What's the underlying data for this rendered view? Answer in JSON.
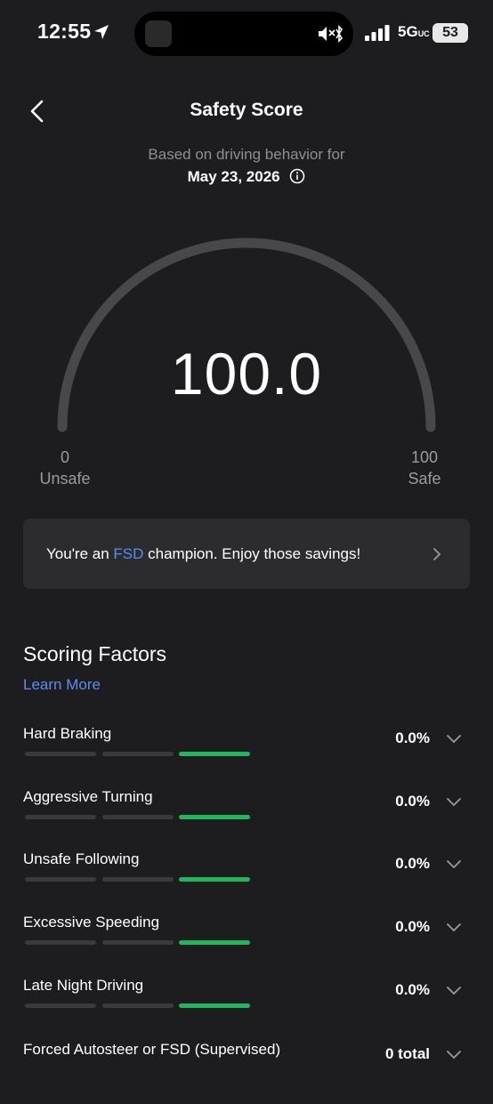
{
  "status_bar": {
    "time": "12:55",
    "network": "5G",
    "network_suffix": "UC",
    "battery": "53"
  },
  "header": {
    "title": "Safety Score",
    "subtitle": "Based on driving behavior for",
    "date": "May 23, 2026"
  },
  "gauge": {
    "score": "100.0",
    "min_value": "0",
    "min_label": "Unsafe",
    "max_value": "100",
    "max_label": "Safe"
  },
  "banner": {
    "text_before": "You're an ",
    "highlight": "FSD",
    "text_after": " champion. Enjoy those savings!"
  },
  "scoring": {
    "title": "Scoring Factors",
    "learn_more": "Learn More",
    "factors": [
      {
        "name": "Hard Braking",
        "value": "0.0%",
        "level": 3
      },
      {
        "name": "Aggressive Turning",
        "value": "0.0%",
        "level": 3
      },
      {
        "name": "Unsafe Following",
        "value": "0.0%",
        "level": 3
      },
      {
        "name": "Excessive Speeding",
        "value": "0.0%",
        "level": 3
      },
      {
        "name": "Late Night Driving",
        "value": "0.0%",
        "level": 3
      },
      {
        "name": "Forced Autosteer or FSD (Supervised)",
        "value": "0 total",
        "level": 0
      }
    ]
  },
  "colors": {
    "background": "#1d1d1f",
    "card": "#2c2c2e",
    "accent_blue": "#5b8def",
    "good_green": "#1fb85c",
    "inactive_bar": "#3a3a3c",
    "gauge_track": "#48484a"
  }
}
